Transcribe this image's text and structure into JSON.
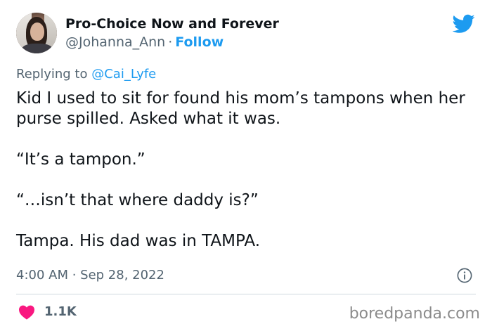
{
  "author": {
    "display_name": "Pro-Choice Now and Forever",
    "handle": "@Johanna_Ann",
    "separator": "·",
    "follow_label": "Follow"
  },
  "reply": {
    "prefix": "Replying to",
    "mention": "@Cai_Lyfe"
  },
  "tweet": {
    "lines": [
      "Kid I used to sit for found his mom’s tampons when her purse spilled. Asked what it was.",
      "“It’s a tampon.”",
      "“…isn’t that where daddy is?”",
      "Tampa. His dad was in TAMPA."
    ],
    "timestamp": "4:00 AM · Sep 28, 2022"
  },
  "engagement": {
    "likes": "1.1K"
  },
  "watermark": "boredpanda.com",
  "icons": {
    "brand": "twitter-bird-icon",
    "info": "info-icon",
    "like": "heart-icon"
  },
  "colors": {
    "accent": "#1d9bf0",
    "heart": "#f91880",
    "secondary_text": "#536471",
    "primary_text": "#0f1419"
  }
}
